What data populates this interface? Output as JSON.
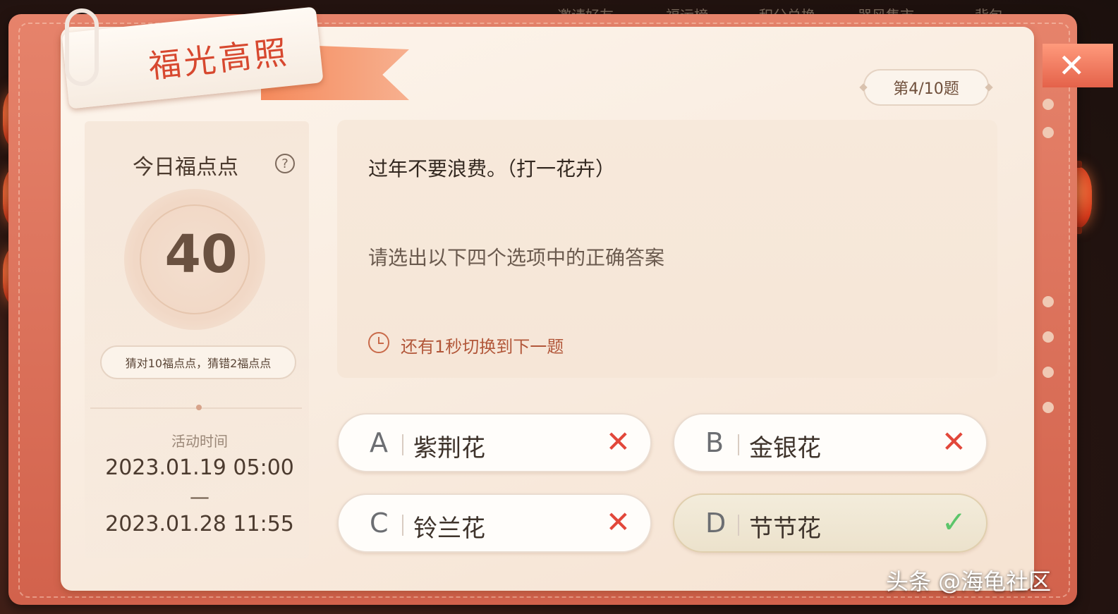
{
  "top_nav": [
    "邀请好友",
    "福运榜",
    "积分兑换",
    "器风集市",
    "背包"
  ],
  "title": "福光高照",
  "progress": "第4/10题",
  "left_panel": {
    "points_label": "今日福点点",
    "help_icon": "?",
    "points_value": "40",
    "rule": "猜对10福点点，猜错2福点点",
    "time_label": "活动时间",
    "time_start": "2023.01.19 05:00",
    "time_separator": "—",
    "time_end": "2023.01.28 11:55"
  },
  "question": {
    "text": "过年不要浪费。（打一花卉）",
    "instruction": "请选出以下四个选项中的正确答案",
    "countdown": "还有1秒切换到下一题"
  },
  "options": [
    {
      "letter": "A",
      "text": "紫荆花",
      "result": "wrong",
      "mark": "✕"
    },
    {
      "letter": "B",
      "text": "金银花",
      "result": "wrong",
      "mark": "✕"
    },
    {
      "letter": "C",
      "text": "铃兰花",
      "result": "wrong",
      "mark": "✕"
    },
    {
      "letter": "D",
      "text": "节节花",
      "result": "correct",
      "mark": "✓"
    }
  ],
  "close_icon": "✕",
  "watermark": "头条 @海龟社区",
  "colors": {
    "accent": "#d7482f",
    "correct": "#5cc56a",
    "wrong": "#e2473a"
  }
}
